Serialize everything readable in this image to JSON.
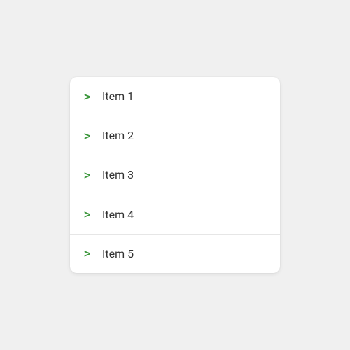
{
  "icon_name": "chevron-right-icon",
  "list": {
    "items": [
      {
        "label": "Item 1"
      },
      {
        "label": "Item 2"
      },
      {
        "label": "Item 3"
      },
      {
        "label": "Item 4"
      },
      {
        "label": "Item 5"
      }
    ]
  }
}
